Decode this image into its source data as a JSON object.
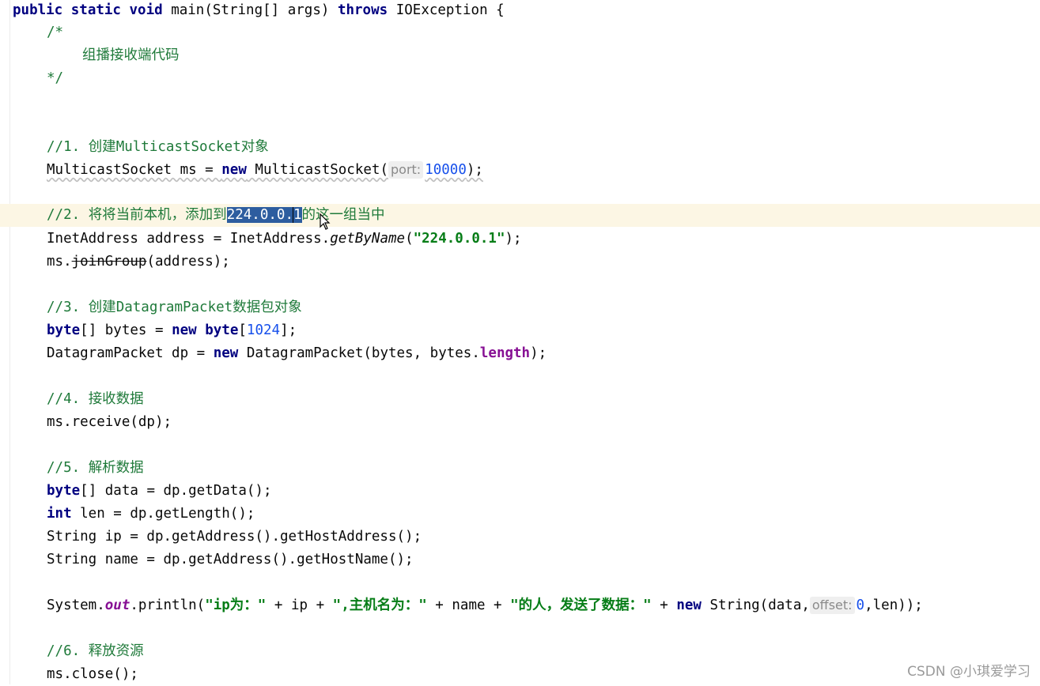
{
  "signature": {
    "mods": "public static void",
    "name": "main",
    "params": "(String[] args)",
    "throws_kw": "throws",
    "exception": "IOException {"
  },
  "doc": {
    "open": "/*",
    "text": "组播接收端代码",
    "close": "*/"
  },
  "step1": {
    "comment_prefix": "//1. ",
    "comment_cn1": "创建",
    "comment_en": "MulticastSocket",
    "comment_cn2": "对象",
    "code_type": "MulticastSocket ms = ",
    "kw_new": "new",
    "ctor": " MulticastSocket(",
    "hint": "port:",
    "port": "10000",
    "end": ");"
  },
  "step2": {
    "comment_prefix": "//2. ",
    "comment_cn1": "将将当前本机，添加到",
    "selected": "224.0.0.",
    "after_caret": "1",
    "comment_cn2": "的这一组当中",
    "decl": "InetAddress address = InetAddress.",
    "method": "getByName",
    "paren_open": "(",
    "str": "\"224.0.0.1\"",
    "paren_close": ");",
    "join_prefix": "ms.",
    "join_method": "joinGroup",
    "join_args": "(address);"
  },
  "step3": {
    "comment_prefix": "//3. ",
    "comment_cn1": "创建",
    "comment_en": "DatagramPacket",
    "comment_cn2": "数据包对象",
    "byte_kw": "byte",
    "bytes_decl": "[] bytes = ",
    "kw_new": "new",
    "byte_kw2": "byte",
    "bracket_open": "[",
    "size": "1024",
    "bracket_close": "];",
    "dp_decl": "DatagramPacket dp = ",
    "kw_new2": "new",
    "dp_ctor": " DatagramPacket(bytes, bytes.",
    "length": "length",
    "dp_end": ");"
  },
  "step4": {
    "comment_prefix": "//4. ",
    "comment_cn": "接收数据",
    "code": "ms.receive(dp);"
  },
  "step5": {
    "comment_prefix": "//5. ",
    "comment_cn": "解析数据",
    "byte_kw": "byte",
    "data_line": "[] data = dp.getData();",
    "int_kw": "int",
    "len_line": " len = dp.getLength();",
    "ip_line": "String ip = dp.getAddress().getHostAddress();",
    "name_line": "String name = dp.getAddress().getHostName();"
  },
  "println": {
    "prefix": "System.",
    "out": "out",
    "call": ".println(",
    "str1": "\"ip为：\"",
    "plus_ip": " + ip + ",
    "str2": "\",主机名为：\"",
    "plus_name": " + name + ",
    "str3": "\"的人，发送了数据：\"",
    "plus": " + ",
    "kw_new": "new",
    "ctor": " String(data,",
    "hint": "offset:",
    "offset": "0",
    "end": ",len));"
  },
  "step6": {
    "comment_prefix": "//6. ",
    "comment_cn": "释放资源",
    "code": "ms.close();"
  },
  "watermark": "CSDN @小琪爱学习"
}
